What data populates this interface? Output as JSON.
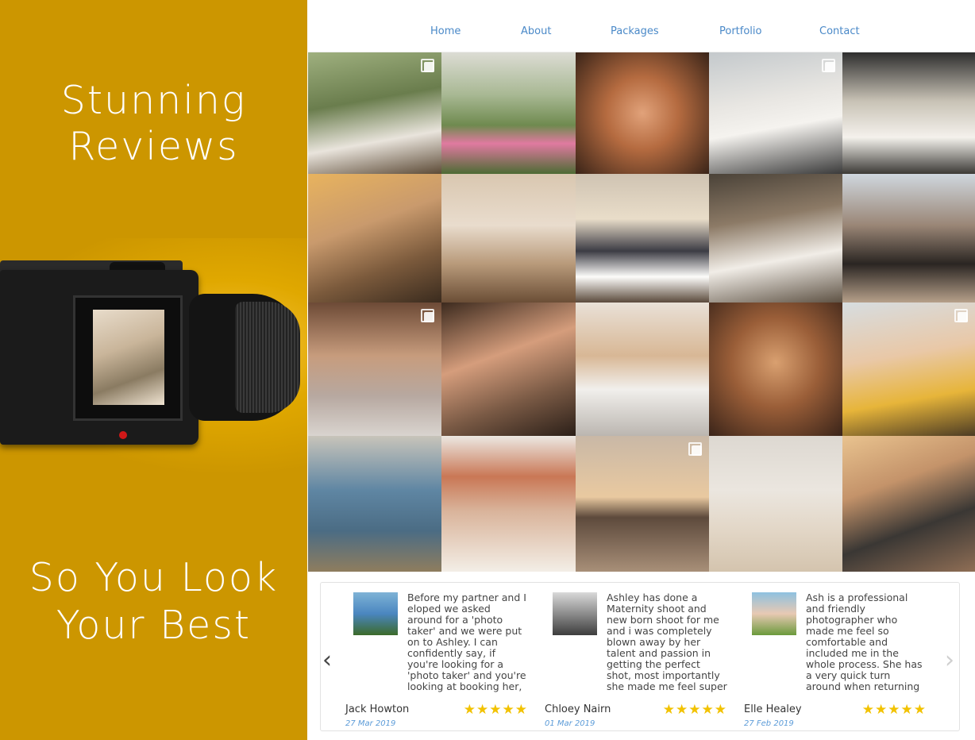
{
  "left_panel": {
    "headline_top": [
      "Stunning",
      "Reviews"
    ],
    "headline_bottom": [
      "So You Look",
      "Your Best"
    ],
    "accent_color": "#cc9600"
  },
  "nav": {
    "items": [
      "Home",
      "About",
      "Packages",
      "Portfolio",
      "Contact"
    ],
    "color": "#4a89c8"
  },
  "gallery": {
    "tiles": [
      {
        "bg": "linear-gradient(170deg,#9fb07f 0%,#6a7d4d 40%,#e9e4dc 70%,#5c4a36 100%)",
        "multi": true
      },
      {
        "bg": "linear-gradient(180deg,#dcdcd4 0%,#a8b893 35%,#6f8a4f 60%,#e07aa0 75%,#4d6b34 100%)",
        "multi": false
      },
      {
        "bg": "radial-gradient(circle at 50% 50%,#e1a27a 0%,#b56b40 40%,#3a2418 100%)",
        "multi": false
      },
      {
        "bg": "linear-gradient(170deg,#c4c9cc 0%,#e8e6e2 40%,#f5f3ef 60%,#3a3a3a 100%)",
        "multi": true
      },
      {
        "bg": "linear-gradient(180deg,#2e2e2e 0%,#c8c2b5 40%,#f4f1ec 70%,#3c3a36 100%)",
        "multi": false
      },
      {
        "bg": "linear-gradient(160deg,#e8b35e 0%,#c99a6d 40%,#7b5a3c 70%,#3a2b1e 100%)",
        "multi": false
      },
      {
        "bg": "linear-gradient(180deg,#d9c7b0 0%,#e9dccd 40%,#b89a7a 70%,#6b4e36 100%)",
        "multi": false
      },
      {
        "bg": "linear-gradient(180deg,#cfc3b2 0%,#e9ddc9 35%,#3c3c44 60%,#fdfcfa 80%,#5b4a3b 100%)",
        "multi": false
      },
      {
        "bg": "linear-gradient(170deg,#4a4238 0%,#8c7a66 35%,#f1ede7 65%,#5e5244 100%)",
        "multi": false
      },
      {
        "bg": "linear-gradient(180deg,#cfd7de 0%,#9a8676 40%,#2a2522 70%,#b6a08a 100%)",
        "multi": false
      },
      {
        "bg": "linear-gradient(180deg,#6d4a36 0%,#c79c7d 40%,#b7a8a0 70%,#d9d4cf 100%)",
        "multi": true
      },
      {
        "bg": "linear-gradient(160deg,#3c2a1e 0%,#d59d7c 40%,#7a5a45 70%,#2b1f18 100%)",
        "multi": false
      },
      {
        "bg": "linear-gradient(180deg,#e9e1d7 0%,#d8b795 40%,#f1efec 65%,#bbb6b0 100%)",
        "multi": false
      },
      {
        "bg": "radial-gradient(circle at 50% 45%,#d9a070 0%,#9a5e38 45%,#3a2419 100%)",
        "multi": false
      },
      {
        "bg": "linear-gradient(170deg,#d7dde0 0%,#e9c8a7 40%,#e7b53a 70%,#4d3c24 100%)",
        "multi": true
      },
      {
        "bg": "linear-gradient(180deg,#c8c4ba 0%,#5f86a3 40%,#4b6c84 70%,#8f7d5e 100%)",
        "multi": false
      },
      {
        "bg": "linear-gradient(180deg,#ece8e2 0%,#c97755 30%,#d9b39a 55%,#f3eee6 100%)",
        "multi": false
      },
      {
        "bg": "linear-gradient(180deg,#c9b8a6 0%,#e9c9a0 45%,#5d4a3c 60%,#a88f78 100%)",
        "multi": true
      },
      {
        "bg": "linear-gradient(180deg,#ddd8d1 0%,#ebe6df 40%,#e2d6c6 70%,#d4c4ae 100%)",
        "multi": false
      },
      {
        "bg": "linear-gradient(160deg,#e9c38f 0%,#c4936a 35%,#3a3734 65%,#8f6e55 100%)",
        "multi": false
      }
    ]
  },
  "reviews": {
    "items": [
      {
        "avatar_bg": "linear-gradient(180deg,#7fb3d6 0%,#4a86c0 50%,#3c6b2a 100%)",
        "text": "Before my partner and I eloped we asked around for a 'photo taker' and we were put on to Ashley. I can confidently say, if you're looking for a 'photo taker' and you're looking at booking her, you're going to get a WHOLE lot more than just a photo taker! Very professional, full of great",
        "name": "Jack Howton",
        "date": "27 Mar 2019",
        "stars": "★★★★★"
      },
      {
        "avatar_bg": "linear-gradient(180deg,#d9d9d9 0%,#8c8c8c 50%,#3d3d3d 100%)",
        "text": "Ashley has done a Maternity shoot and new born shoot for me and i was completely blown away by her talent and passion in getting the perfect shot, most importantly she made me feel super comfortable which was something i was nervous about, because of this",
        "name": "Chloey Nairn",
        "date": "01 Mar 2019",
        "stars": "★★★★★"
      },
      {
        "avatar_bg": "linear-gradient(180deg,#8ec1e0 0%,#e8c9b3 50%,#6b9a3c 100%)",
        "text": "Ash is a professional and friendly photographer who made me feel so comfortable and included me in the whole process. She has a very quick turn around when returning images and was an absolute delight to spend a morning with. Absolutely recommend ash",
        "name": "Elle Healey",
        "date": "27 Feb 2019",
        "stars": "★★★★★"
      }
    ],
    "prev_arrow": "‹",
    "next_arrow": "›",
    "star_color": "#f2c200"
  }
}
